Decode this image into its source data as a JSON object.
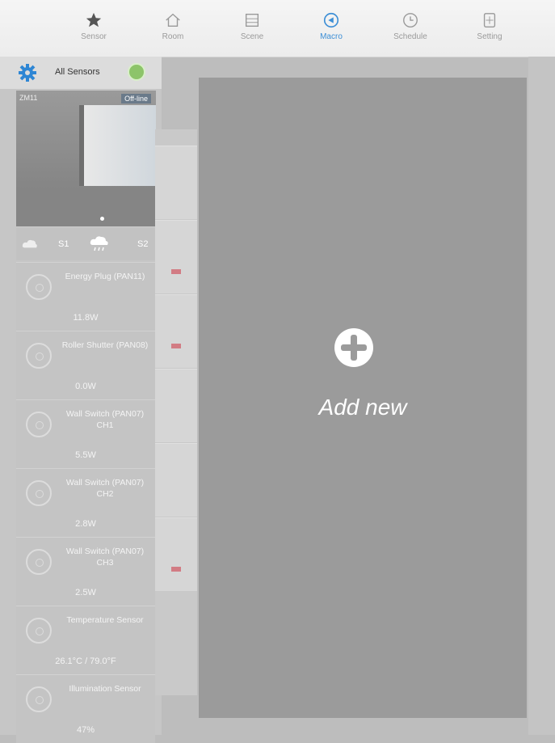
{
  "tabs": [
    {
      "label": "Sensor",
      "icon": "star-icon"
    },
    {
      "label": "Room",
      "icon": "house-icon"
    },
    {
      "label": "Scene",
      "icon": "scene-icon"
    },
    {
      "label": "Macro",
      "icon": "macro-icon",
      "active": true
    },
    {
      "label": "Schedule",
      "icon": "clock-icon"
    },
    {
      "label": "Setting",
      "icon": "setting-icon"
    }
  ],
  "sidebar": {
    "title": "All Sensors",
    "camera": {
      "label": "ZM11",
      "badge": "Off-line"
    },
    "weather": {
      "s1": "S1",
      "s2": "S2"
    },
    "devices": [
      {
        "name": "Energy Plug (PAN11)",
        "value": "11.8W"
      },
      {
        "name": "Roller Shutter (PAN08)",
        "value": "0.0W"
      },
      {
        "name": "Wall Switch (PAN07) CH1",
        "value": "5.5W"
      },
      {
        "name": "Wall Switch (PAN07) CH2",
        "value": "2.8W"
      },
      {
        "name": "Wall Switch (PAN07) CH3",
        "value": "2.5W"
      },
      {
        "name": "Temperature Sensor",
        "value": "26.1°C / 79.0°F"
      },
      {
        "name": "Illumination Sensor",
        "value": "47%"
      }
    ]
  },
  "main": {
    "add_label": "Add new"
  },
  "colors": {
    "accent": "#3d8fd6",
    "status_online": "#8dc46a"
  }
}
